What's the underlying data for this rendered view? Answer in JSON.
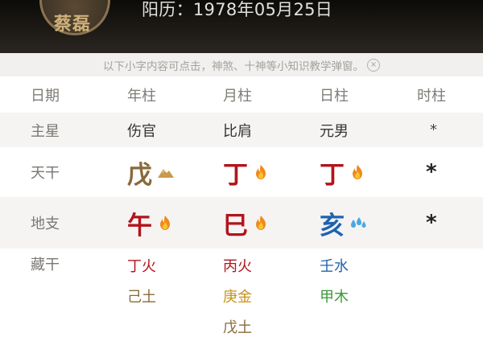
{
  "header": {
    "name": "蔡磊",
    "solar_date": "阳历：1978年05月25日"
  },
  "hint": {
    "text": "以下小字内容可点击，神煞、十神等小知识教学弹窗。",
    "close": "×"
  },
  "columns": [
    "日期",
    "年柱",
    "月柱",
    "日柱",
    "时柱"
  ],
  "rows": {
    "main_star": {
      "label": "主星",
      "values": [
        "伤官",
        "比肩",
        "元男",
        "*"
      ]
    },
    "heaven_stem": {
      "label": "天干",
      "cells": [
        {
          "char": "戊",
          "color": "#8a6a3a",
          "icon": "earth-icon"
        },
        {
          "char": "丁",
          "color": "#b3141b",
          "icon": "fire-icon"
        },
        {
          "char": "丁",
          "color": "#b3141b",
          "icon": "fire-icon"
        },
        {
          "char": "*",
          "color": "#222222",
          "icon": ""
        }
      ]
    },
    "earth_branch": {
      "label": "地支",
      "cells": [
        {
          "char": "午",
          "color": "#b3141b",
          "icon": "fire-icon"
        },
        {
          "char": "巳",
          "color": "#b3141b",
          "icon": "fire-icon"
        },
        {
          "char": "亥",
          "color": "#1f63b0",
          "icon": "water-icon"
        },
        {
          "char": "*",
          "color": "#222222",
          "icon": ""
        }
      ]
    },
    "hidden_stem": {
      "label": "藏干",
      "columns": [
        [
          {
            "text": "丁火",
            "color": "#b3141b"
          },
          {
            "text": "己土",
            "color": "#8a6a3a"
          }
        ],
        [
          {
            "text": "丙火",
            "color": "#b3141b"
          },
          {
            "text": "庚金",
            "color": "#c9921b"
          },
          {
            "text": "戊土",
            "color": "#8a6a3a"
          }
        ],
        [
          {
            "text": "壬水",
            "color": "#1f63b0"
          },
          {
            "text": "甲木",
            "color": "#3a9a3a"
          }
        ]
      ]
    }
  },
  "colors": {
    "fire": "#b3141b",
    "earth": "#8a6a3a",
    "water": "#1f63b0",
    "wood": "#3a9a3a",
    "metal": "#c9921b"
  }
}
